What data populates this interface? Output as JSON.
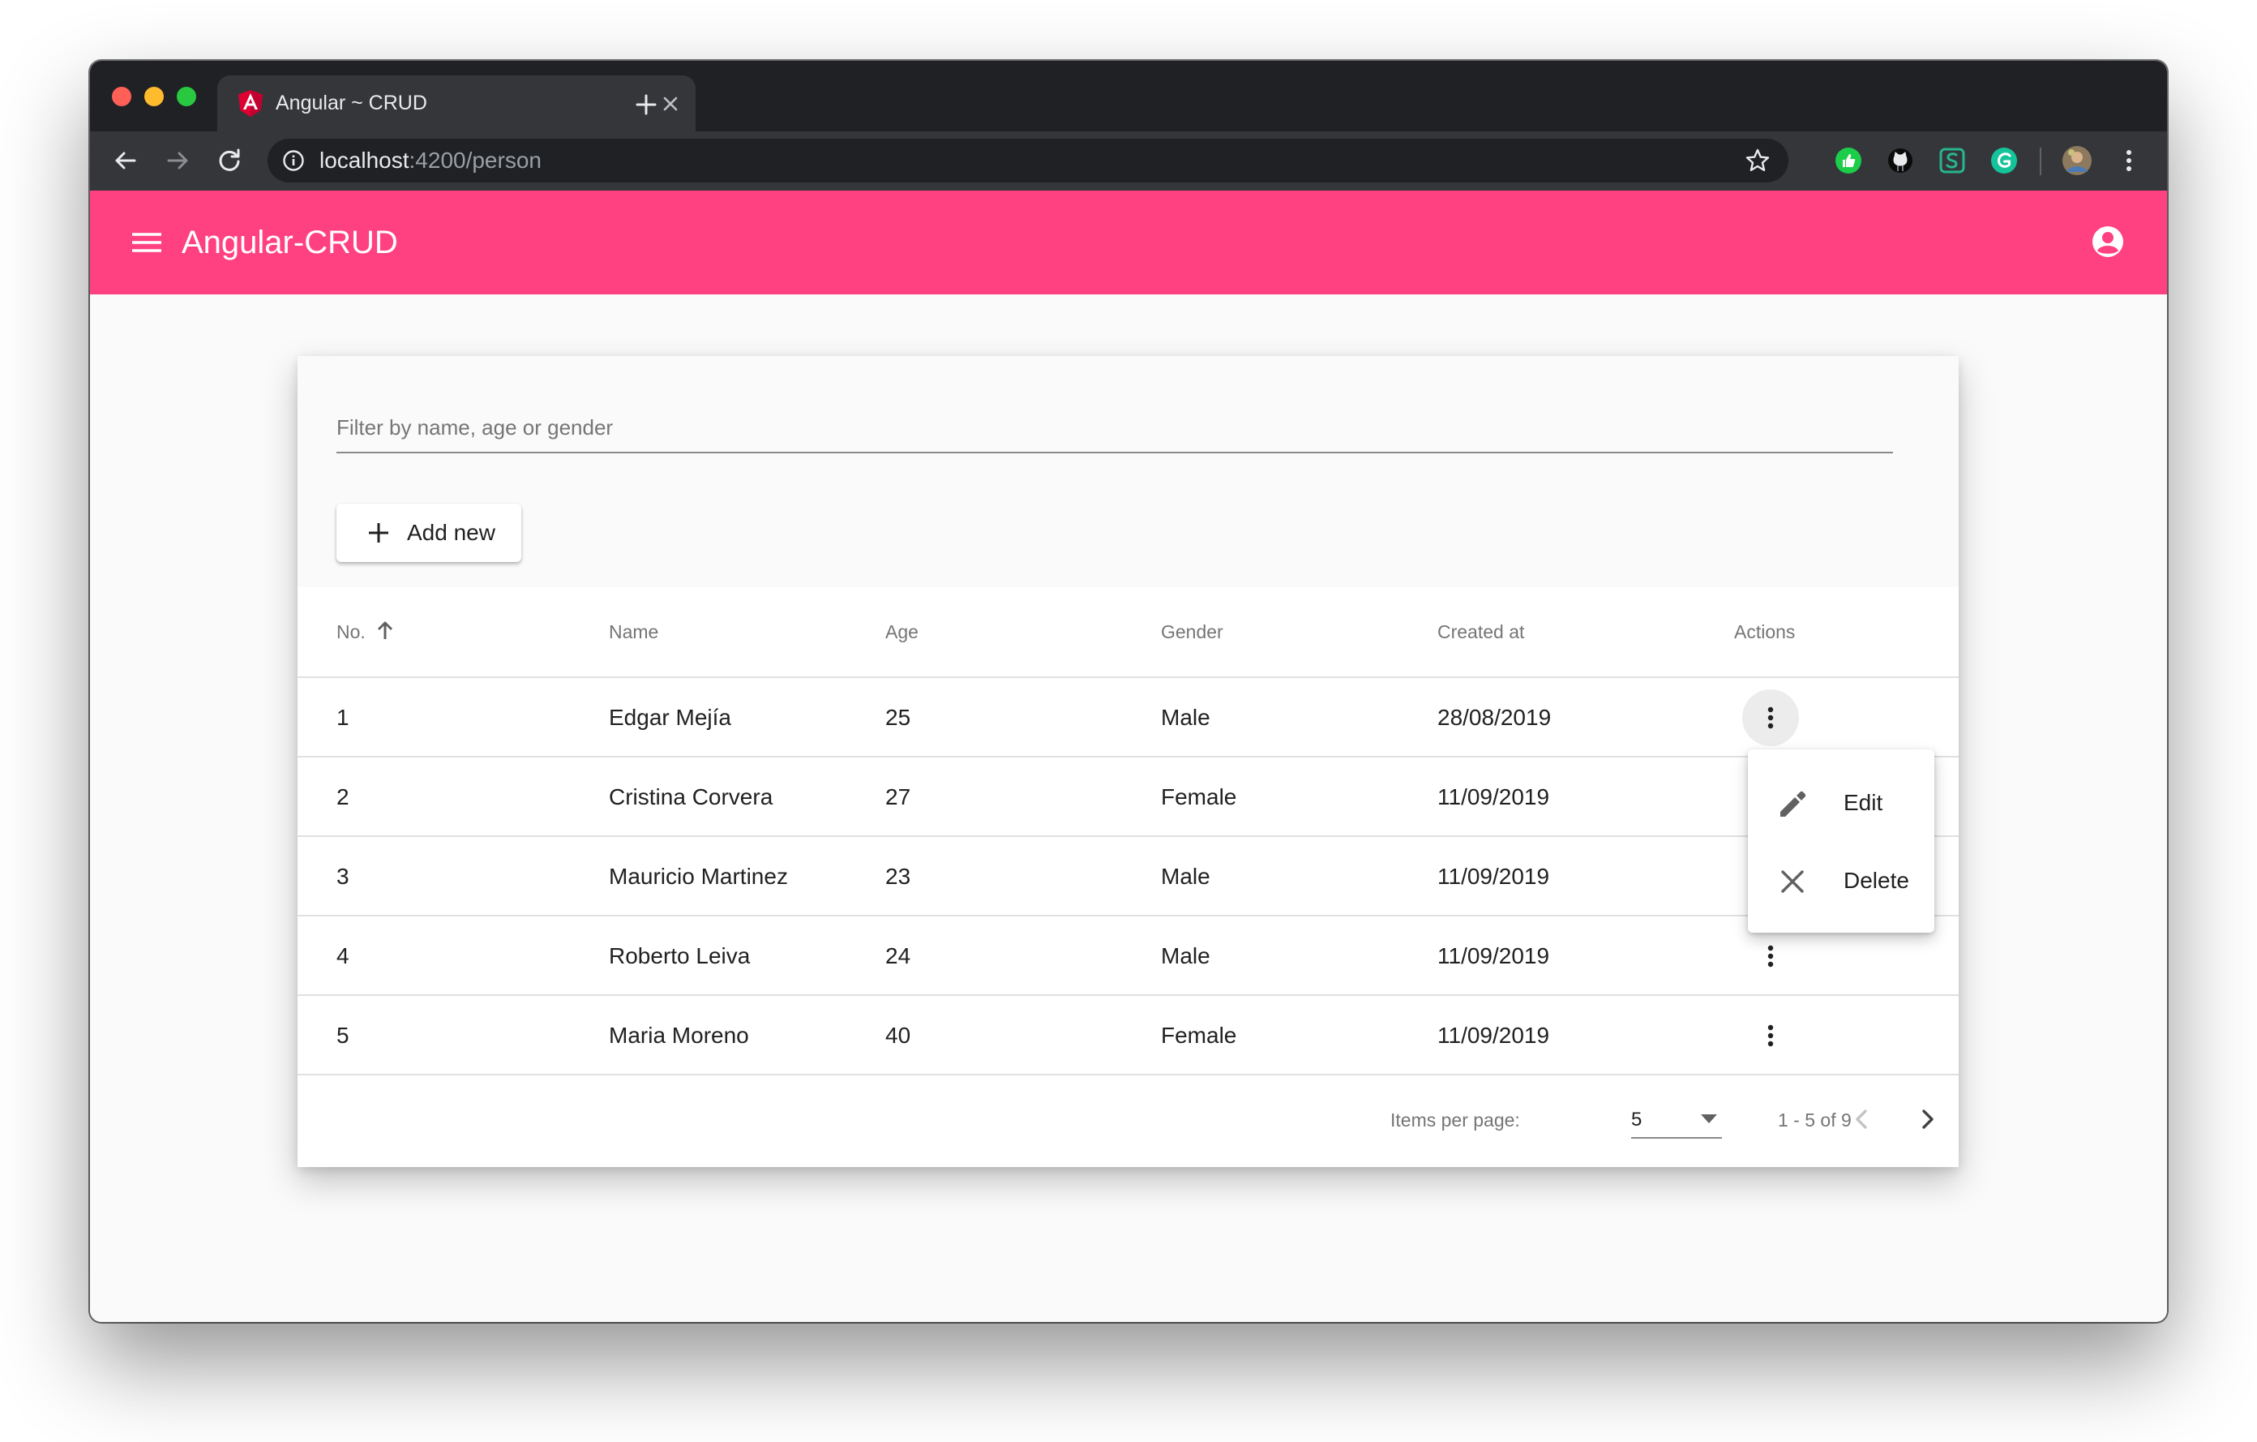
{
  "browser": {
    "tab_title": "Angular ~ CRUD",
    "url_host": "localhost",
    "url_path": ":4200/person"
  },
  "app": {
    "title": "Angular-CRUD",
    "accent_color": "#ff4081"
  },
  "filter": {
    "placeholder": "Filter by name, age or gender"
  },
  "add_button": {
    "label": "Add new",
    "icon": "plus-icon"
  },
  "table": {
    "columns": [
      "No.",
      "Name",
      "Age",
      "Gender",
      "Created at",
      "Actions"
    ],
    "sort": {
      "column": "No.",
      "direction": "ascending",
      "icon": "arrow-up-icon"
    },
    "rows": [
      {
        "no": "1",
        "name": "Edgar Mejía",
        "age": "25",
        "gender": "Male",
        "created": "28/08/2019"
      },
      {
        "no": "2",
        "name": "Cristina Corvera",
        "age": "27",
        "gender": "Female",
        "created": "11/09/2019"
      },
      {
        "no": "3",
        "name": "Mauricio Martinez",
        "age": "23",
        "gender": "Male",
        "created": "11/09/2019"
      },
      {
        "no": "4",
        "name": "Roberto Leiva",
        "age": "24",
        "gender": "Male",
        "created": "11/09/2019"
      },
      {
        "no": "5",
        "name": "Maria Moreno",
        "age": "40",
        "gender": "Female",
        "created": "11/09/2019"
      }
    ]
  },
  "row_menu": {
    "items": [
      {
        "label": "Edit",
        "icon": "pencil-icon"
      },
      {
        "label": "Delete",
        "icon": "close-icon"
      }
    ]
  },
  "paginator": {
    "items_per_page_label": "Items per page:",
    "page_size": "5",
    "range_label": "1 - 5 of 9"
  }
}
